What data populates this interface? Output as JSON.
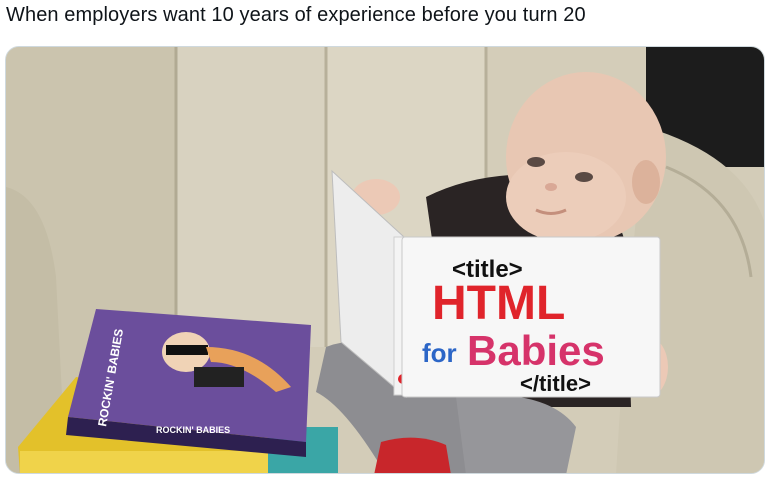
{
  "post": {
    "caption": "When employers want 10 years of experience before you turn 20"
  },
  "photo": {
    "book_cover": {
      "open_tag": "<title>",
      "line1": "HTML",
      "for_word": "for",
      "line2": "Babies",
      "close_tag": "</title>"
    },
    "side_book": {
      "spine_text": "ROCKIN' BABIES",
      "bottom_text": "ROCKIN' BABIES"
    },
    "colors": {
      "html_red": "#e0242b",
      "babies_pink": "#d6336a",
      "chair": "#cfc8b3"
    }
  }
}
